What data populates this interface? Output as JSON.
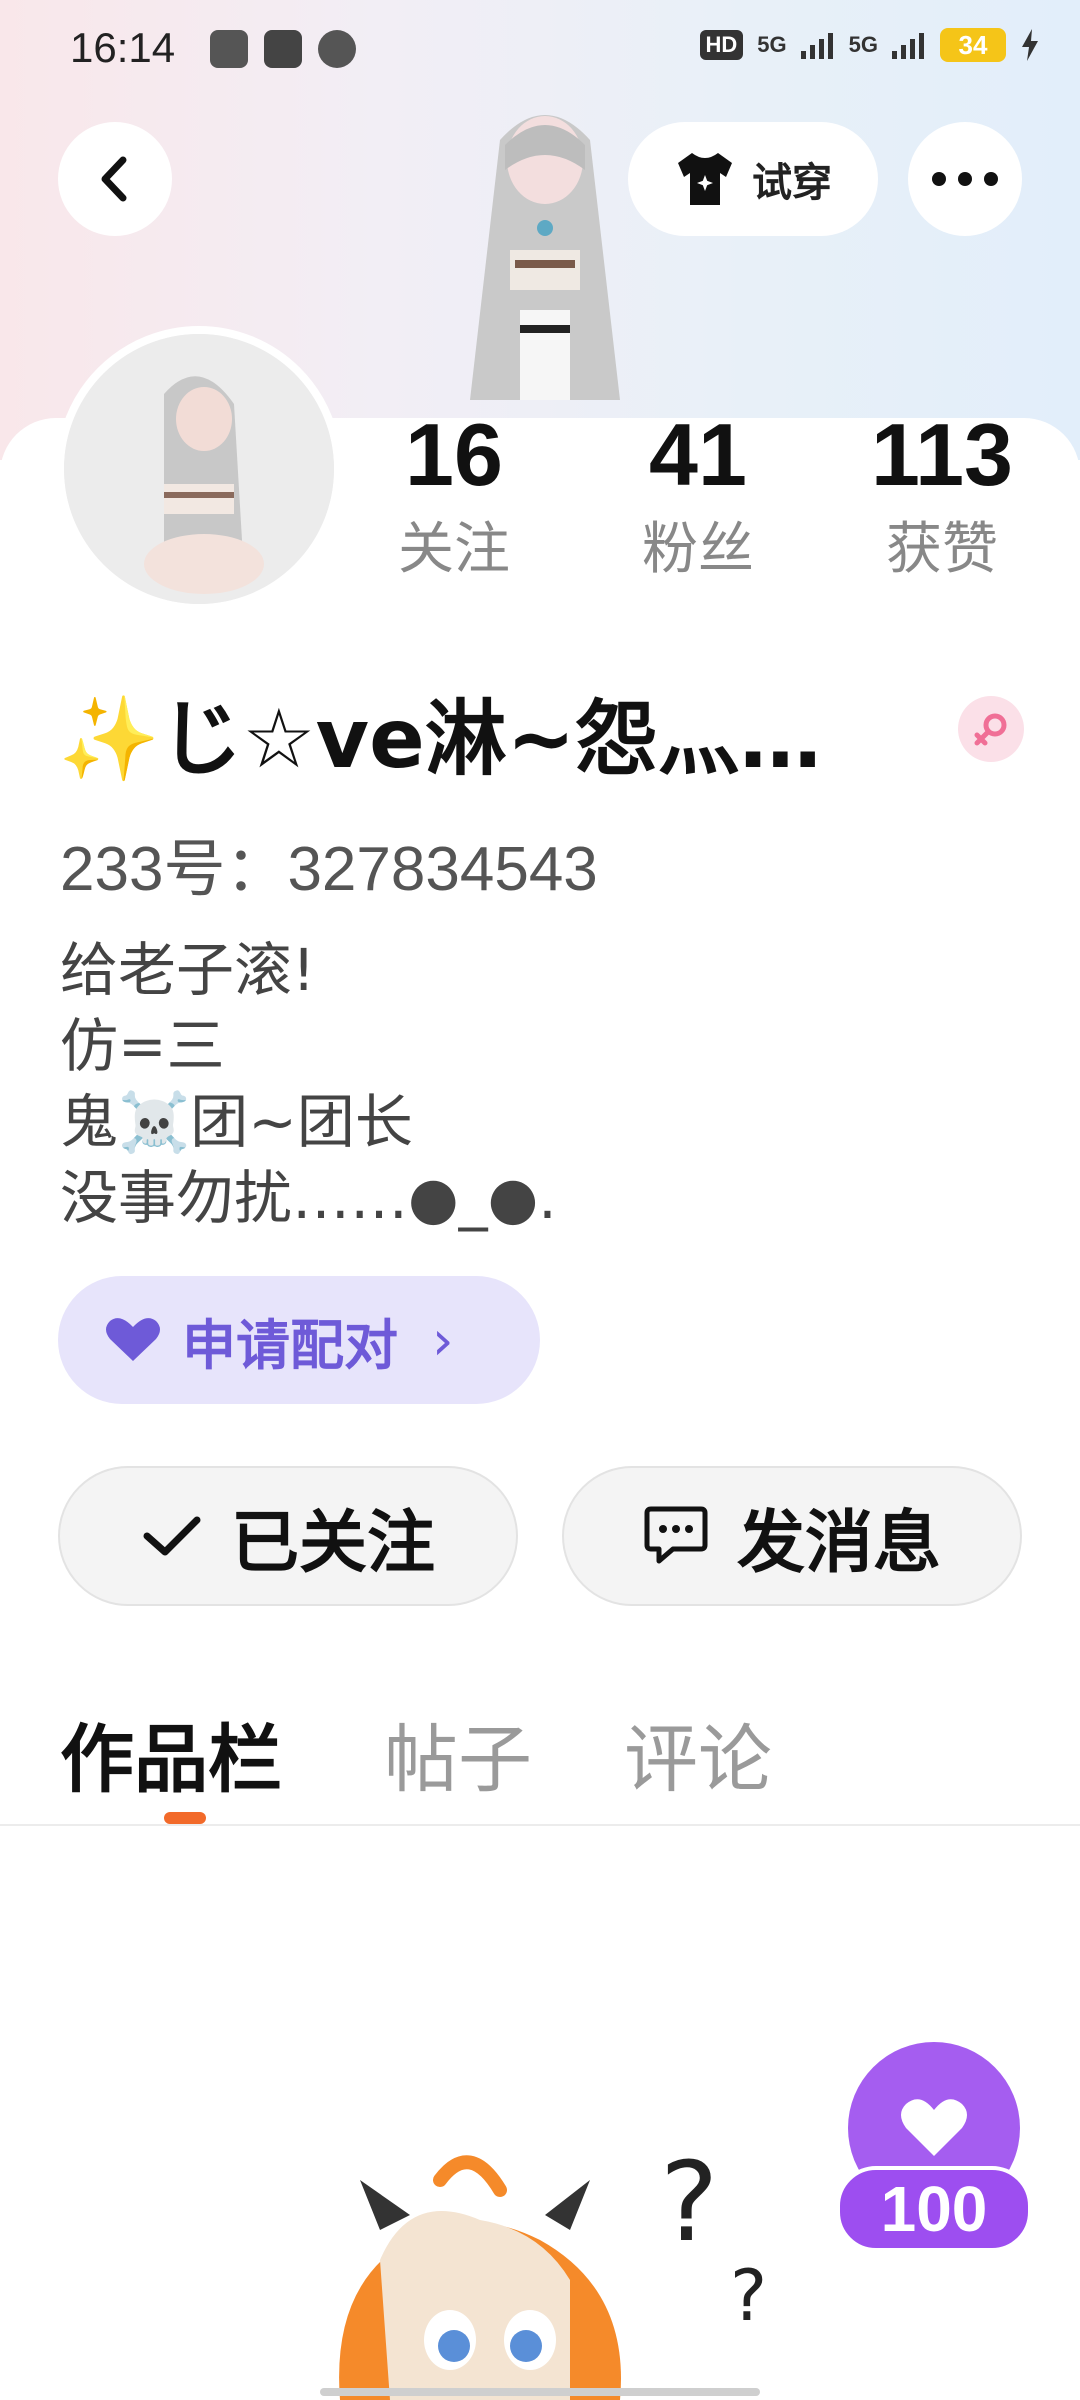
{
  "status_bar": {
    "time": "16:14",
    "network_1": "5G",
    "network_2": "5G",
    "hd_badge": "HD",
    "battery_level": "34"
  },
  "header": {
    "back_icon": "chevron-left-icon",
    "try_on_label": "试穿",
    "more_icon": "more-horizontal-icon"
  },
  "stats": [
    {
      "value": "16",
      "label": "关注"
    },
    {
      "value": "41",
      "label": "粉丝"
    },
    {
      "value": "113",
      "label": "获赞"
    }
  ],
  "profile": {
    "name": "✨じ☆ve淋~怨灬…",
    "gender_icon": "female-icon",
    "uid": "233号：327834543",
    "bio_lines": [
      "给老子滚!",
      "仿=三",
      "鬼☠️团~团长",
      "没事勿扰……●_●."
    ]
  },
  "pair_button": {
    "label": "申请配对",
    "icon": "heart-icon",
    "arrow": "›"
  },
  "actions": {
    "follow_label": "已关注",
    "message_label": "发消息"
  },
  "tabs": [
    {
      "label": "作品栏",
      "active": true
    },
    {
      "label": "帖子",
      "active": false
    },
    {
      "label": "评论",
      "active": false
    }
  ],
  "like_badge": {
    "count": "100"
  },
  "colors": {
    "accent_purple": "#6e5ad8",
    "tab_indicator": "#f26a2a",
    "like_purple": "#a55df0",
    "battery": "#f5c518"
  }
}
